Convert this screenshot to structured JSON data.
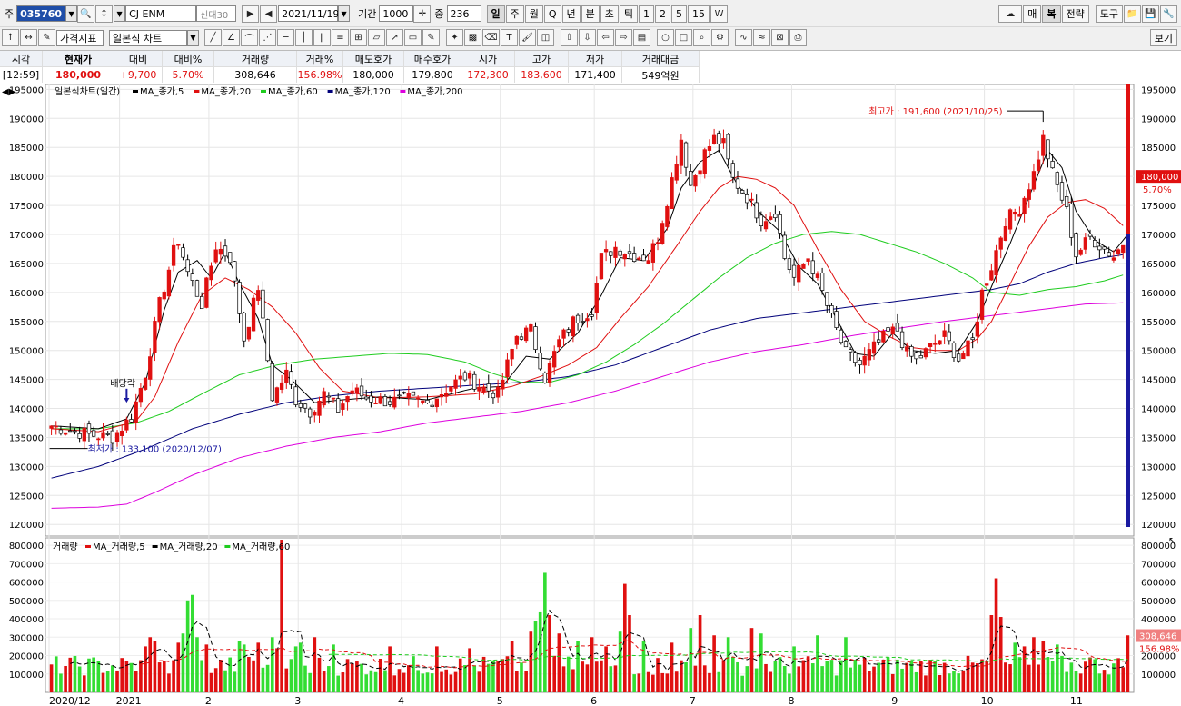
{
  "toolbar1": {
    "market_label": "주",
    "code": "035760",
    "stock_name": "CJ ENM",
    "credit_tag": "신대30",
    "date": "2021/11/19",
    "period_label": "기간",
    "period_value": "1000",
    "count_label": "중",
    "count_value": "236",
    "periods": [
      "일",
      "주",
      "월",
      "Q",
      "년",
      "분",
      "초",
      "틱",
      "1",
      "2",
      "5",
      "15"
    ],
    "right_buttons": [
      "매",
      "복",
      "전략",
      "도구"
    ]
  },
  "toolbar2": {
    "indicator_dd": "가격지표",
    "chart_type_dd": "일본식 차트",
    "view_button": "보기"
  },
  "quote": {
    "headers": [
      "시각",
      "현재가",
      "대비",
      "대비%",
      "거래량",
      "거래%",
      "매도호가",
      "매수호가",
      "시가",
      "고가",
      "저가",
      "거래대금"
    ],
    "values": [
      "[12:59]",
      "180,000",
      "+9,700",
      "5.70%",
      "308,646",
      "156.98%",
      "180,000",
      "179,800",
      "172,300",
      "183,600",
      "171,400",
      "549억원"
    ]
  },
  "chart_data": {
    "type": "candlestick",
    "title": "일본식차트(일간)",
    "legend": [
      {
        "name": "MA_종가,5",
        "color": "#000000"
      },
      {
        "name": "MA_종가,20",
        "color": "#e01010"
      },
      {
        "name": "MA_종가,60",
        "color": "#1fcc1f"
      },
      {
        "name": "MA_종가,120",
        "color": "#00007a"
      },
      {
        "name": "MA_종가,200",
        "color": "#dd00dd"
      }
    ],
    "ylim": [
      118000,
      196000
    ],
    "y_ticks": [
      120000,
      125000,
      130000,
      135000,
      140000,
      145000,
      150000,
      155000,
      160000,
      165000,
      170000,
      175000,
      180000,
      185000,
      190000,
      195000
    ],
    "x_labels": [
      {
        "label": "2020/12",
        "index": 0
      },
      {
        "label": "2021",
        "index": 15
      },
      {
        "label": "2",
        "index": 34
      },
      {
        "label": "3",
        "index": 53
      },
      {
        "label": "4",
        "index": 75
      },
      {
        "label": "5",
        "index": 96
      },
      {
        "label": "6",
        "index": 116
      },
      {
        "label": "7",
        "index": 137
      },
      {
        "label": "8",
        "index": 158
      },
      {
        "label": "9",
        "index": 180
      },
      {
        "label": "10",
        "index": 199
      },
      {
        "label": "11",
        "index": 218
      }
    ],
    "close_path": [
      [
        0,
        137000
      ],
      [
        8,
        135500
      ],
      [
        13,
        135000
      ],
      [
        17,
        138500
      ],
      [
        20,
        146000
      ],
      [
        23,
        158000
      ],
      [
        26,
        167000
      ],
      [
        27,
        169000
      ],
      [
        29,
        163500
      ],
      [
        32,
        158000
      ],
      [
        35,
        168000
      ],
      [
        38,
        166000
      ],
      [
        41,
        152000
      ],
      [
        44,
        161000
      ],
      [
        47,
        142000
      ],
      [
        50,
        146000
      ],
      [
        52,
        141500
      ],
      [
        55,
        139500
      ],
      [
        58,
        142500
      ],
      [
        61,
        139800
      ],
      [
        64,
        143200
      ],
      [
        67,
        141800
      ],
      [
        72,
        141200
      ],
      [
        76,
        141600
      ],
      [
        80,
        140800
      ],
      [
        85,
        144000
      ],
      [
        88,
        145500
      ],
      [
        92,
        143500
      ],
      [
        95,
        142500
      ],
      [
        99,
        152500
      ],
      [
        102,
        153500
      ],
      [
        105,
        145200
      ],
      [
        108,
        151500
      ],
      [
        111,
        155000
      ],
      [
        115,
        157000
      ],
      [
        117,
        166000
      ],
      [
        120,
        167800
      ],
      [
        124,
        166400
      ],
      [
        127,
        166000
      ],
      [
        129,
        169500
      ],
      [
        131,
        176000
      ],
      [
        134,
        186500
      ],
      [
        136,
        178500
      ],
      [
        139,
        184000
      ],
      [
        141,
        186500
      ],
      [
        143,
        185500
      ],
      [
        145,
        179500
      ],
      [
        148,
        176500
      ],
      [
        151,
        172500
      ],
      [
        154,
        174000
      ],
      [
        156,
        166000
      ],
      [
        158,
        162500
      ],
      [
        161,
        166000
      ],
      [
        163,
        162200
      ],
      [
        166,
        155500
      ],
      [
        169,
        149500
      ],
      [
        172,
        147500
      ],
      [
        175,
        150500
      ],
      [
        178,
        153000
      ],
      [
        180,
        153500
      ],
      [
        182,
        149500
      ],
      [
        184,
        148200
      ],
      [
        187,
        150500
      ],
      [
        190,
        152500
      ],
      [
        193,
        148500
      ],
      [
        196,
        151500
      ],
      [
        198,
        160000
      ],
      [
        200,
        164500
      ],
      [
        203,
        172500
      ],
      [
        206,
        174500
      ],
      [
        209,
        180500
      ],
      [
        211,
        186500
      ],
      [
        213,
        180500
      ],
      [
        216,
        174000
      ],
      [
        218,
        166500
      ],
      [
        221,
        169500
      ],
      [
        224,
        167500
      ],
      [
        226,
        166200
      ],
      [
        228,
        168500
      ],
      [
        229,
        180000
      ]
    ],
    "ma5": [
      [
        0,
        137000
      ],
      [
        10,
        136500
      ],
      [
        16,
        138200
      ],
      [
        20,
        144500
      ],
      [
        24,
        157000
      ],
      [
        27,
        163500
      ],
      [
        31,
        165500
      ],
      [
        34,
        162500
      ],
      [
        37,
        167000
      ],
      [
        40,
        161500
      ],
      [
        44,
        155500
      ],
      [
        47,
        147500
      ],
      [
        51,
        145000
      ],
      [
        56,
        141000
      ],
      [
        62,
        141500
      ],
      [
        70,
        142000
      ],
      [
        80,
        141500
      ],
      [
        90,
        143500
      ],
      [
        96,
        143800
      ],
      [
        101,
        149000
      ],
      [
        106,
        148500
      ],
      [
        112,
        153000
      ],
      [
        117,
        159500
      ],
      [
        121,
        166000
      ],
      [
        126,
        165500
      ],
      [
        131,
        171000
      ],
      [
        134,
        178000
      ],
      [
        138,
        182500
      ],
      [
        142,
        184500
      ],
      [
        146,
        178500
      ],
      [
        151,
        173500
      ],
      [
        155,
        170500
      ],
      [
        159,
        164500
      ],
      [
        163,
        161500
      ],
      [
        167,
        155500
      ],
      [
        171,
        149500
      ],
      [
        175,
        149000
      ],
      [
        179,
        153000
      ],
      [
        183,
        150000
      ],
      [
        188,
        149500
      ],
      [
        193,
        150000
      ],
      [
        197,
        155000
      ],
      [
        200,
        161000
      ],
      [
        204,
        168500
      ],
      [
        208,
        176500
      ],
      [
        212,
        184500
      ],
      [
        215,
        181500
      ],
      [
        218,
        174000
      ],
      [
        222,
        169000
      ],
      [
        226,
        167000
      ],
      [
        229,
        170000
      ]
    ],
    "ma20": [
      [
        0,
        136500
      ],
      [
        10,
        136000
      ],
      [
        18,
        137800
      ],
      [
        22,
        142000
      ],
      [
        27,
        151500
      ],
      [
        32,
        159500
      ],
      [
        37,
        162500
      ],
      [
        42,
        160500
      ],
      [
        47,
        157500
      ],
      [
        52,
        153000
      ],
      [
        57,
        147000
      ],
      [
        62,
        143000
      ],
      [
        70,
        141800
      ],
      [
        80,
        142000
      ],
      [
        90,
        142500
      ],
      [
        98,
        143800
      ],
      [
        104,
        145500
      ],
      [
        110,
        147500
      ],
      [
        116,
        150500
      ],
      [
        121,
        155500
      ],
      [
        127,
        161000
      ],
      [
        133,
        168000
      ],
      [
        138,
        174000
      ],
      [
        142,
        178000
      ],
      [
        146,
        180000
      ],
      [
        150,
        179500
      ],
      [
        154,
        178000
      ],
      [
        158,
        175000
      ],
      [
        163,
        167500
      ],
      [
        168,
        160500
      ],
      [
        173,
        155000
      ],
      [
        178,
        152500
      ],
      [
        183,
        150500
      ],
      [
        188,
        150000
      ],
      [
        193,
        150000
      ],
      [
        197,
        152000
      ],
      [
        200,
        155000
      ],
      [
        204,
        161500
      ],
      [
        208,
        168000
      ],
      [
        212,
        173000
      ],
      [
        216,
        175500
      ],
      [
        220,
        176000
      ],
      [
        224,
        174500
      ],
      [
        228,
        171500
      ]
    ],
    "ma60": [
      [
        0,
        136500
      ],
      [
        10,
        136500
      ],
      [
        18,
        137500
      ],
      [
        25,
        139500
      ],
      [
        32,
        142500
      ],
      [
        40,
        145800
      ],
      [
        48,
        147500
      ],
      [
        56,
        148500
      ],
      [
        64,
        149000
      ],
      [
        72,
        149500
      ],
      [
        80,
        149300
      ],
      [
        88,
        148000
      ],
      [
        94,
        146000
      ],
      [
        100,
        144500
      ],
      [
        106,
        144500
      ],
      [
        112,
        145800
      ],
      [
        118,
        148000
      ],
      [
        124,
        151000
      ],
      [
        130,
        154500
      ],
      [
        136,
        158500
      ],
      [
        142,
        162500
      ],
      [
        148,
        166000
      ],
      [
        154,
        168500
      ],
      [
        160,
        170000
      ],
      [
        166,
        170500
      ],
      [
        172,
        170000
      ],
      [
        178,
        168500
      ],
      [
        184,
        167000
      ],
      [
        190,
        165000
      ],
      [
        196,
        162500
      ],
      [
        200,
        160000
      ],
      [
        206,
        159500
      ],
      [
        212,
        160500
      ],
      [
        218,
        161000
      ],
      [
        224,
        162000
      ],
      [
        228,
        163000
      ]
    ],
    "ma120": [
      [
        0,
        128000
      ],
      [
        10,
        130000
      ],
      [
        20,
        133000
      ],
      [
        30,
        136500
      ],
      [
        40,
        139000
      ],
      [
        50,
        141000
      ],
      [
        60,
        142200
      ],
      [
        70,
        143000
      ],
      [
        80,
        143500
      ],
      [
        90,
        144000
      ],
      [
        100,
        144500
      ],
      [
        110,
        145500
      ],
      [
        120,
        147500
      ],
      [
        130,
        150500
      ],
      [
        140,
        153500
      ],
      [
        150,
        155500
      ],
      [
        160,
        156500
      ],
      [
        170,
        157500
      ],
      [
        180,
        158500
      ],
      [
        190,
        159500
      ],
      [
        200,
        160500
      ],
      [
        206,
        161500
      ],
      [
        212,
        163500
      ],
      [
        218,
        165000
      ],
      [
        224,
        166000
      ],
      [
        228,
        166500
      ]
    ],
    "ma200": [
      [
        0,
        122800
      ],
      [
        10,
        123000
      ],
      [
        16,
        123500
      ],
      [
        22,
        125500
      ],
      [
        30,
        128500
      ],
      [
        40,
        131500
      ],
      [
        50,
        133500
      ],
      [
        60,
        135000
      ],
      [
        70,
        136000
      ],
      [
        80,
        137500
      ],
      [
        90,
        138500
      ],
      [
        100,
        139500
      ],
      [
        110,
        141000
      ],
      [
        120,
        143000
      ],
      [
        130,
        145500
      ],
      [
        140,
        148000
      ],
      [
        150,
        149800
      ],
      [
        160,
        151000
      ],
      [
        170,
        152500
      ],
      [
        180,
        153800
      ],
      [
        190,
        155000
      ],
      [
        200,
        156000
      ],
      [
        210,
        157000
      ],
      [
        220,
        158000
      ],
      [
        228,
        158200
      ]
    ],
    "annotations": {
      "high": {
        "text": "최고가 : 191,600 (2021/10/25)",
        "value": 191600,
        "index": 211
      },
      "low": {
        "text": "최저가 : 133,100 (2020/12/07)",
        "value": 133100,
        "index": 0
      },
      "dividend": {
        "text": "배당락",
        "index": 16
      }
    },
    "current_price_label": "180,000",
    "change_pct_label": "5.70%",
    "volume": {
      "title": "거래량",
      "legend": [
        {
          "name": "MA_거래량,5",
          "color": "#e01010"
        },
        {
          "name": "MA_거래량,20",
          "color": "#000000"
        },
        {
          "name": "MA_거래량,60",
          "color": "#1fcc1f"
        }
      ],
      "ylim": [
        0,
        840000
      ],
      "y_ticks": [
        100000,
        200000,
        300000,
        400000,
        500000,
        600000,
        700000,
        800000
      ],
      "current_label": "308,646",
      "pct_label": "156.98%",
      "spikes": [
        [
          20,
          250000
        ],
        [
          21,
          300000
        ],
        [
          22,
          280000
        ],
        [
          27,
          270000
        ],
        [
          28,
          320000
        ],
        [
          29,
          500000
        ],
        [
          30,
          530000
        ],
        [
          31,
          300000
        ],
        [
          33,
          260000
        ],
        [
          40,
          280000
        ],
        [
          41,
          260000
        ],
        [
          44,
          270000
        ],
        [
          47,
          300000
        ],
        [
          48,
          240000
        ],
        [
          49,
          830000
        ],
        [
          52,
          250000
        ],
        [
          53,
          270000
        ],
        [
          56,
          300000
        ],
        [
          60,
          260000
        ],
        [
          72,
          250000
        ],
        [
          82,
          250000
        ],
        [
          89,
          240000
        ],
        [
          98,
          280000
        ],
        [
          102,
          330000
        ],
        [
          103,
          390000
        ],
        [
          104,
          440000
        ],
        [
          105,
          650000
        ],
        [
          106,
          420000
        ],
        [
          108,
          320000
        ],
        [
          112,
          280000
        ],
        [
          115,
          300000
        ],
        [
          118,
          250000
        ],
        [
          121,
          330000
        ],
        [
          122,
          590000
        ],
        [
          123,
          420000
        ],
        [
          126,
          280000
        ],
        [
          132,
          270000
        ],
        [
          136,
          350000
        ],
        [
          138,
          420000
        ],
        [
          141,
          310000
        ],
        [
          144,
          300000
        ],
        [
          149,
          350000
        ],
        [
          151,
          320000
        ],
        [
          158,
          250000
        ],
        [
          163,
          310000
        ],
        [
          169,
          300000
        ],
        [
          198,
          180000
        ],
        [
          200,
          420000
        ],
        [
          201,
          620000
        ],
        [
          202,
          410000
        ],
        [
          205,
          270000
        ],
        [
          207,
          250000
        ],
        [
          209,
          300000
        ],
        [
          211,
          280000
        ],
        [
          214,
          260000
        ],
        [
          221,
          190000
        ],
        [
          229,
          310000
        ]
      ]
    }
  }
}
